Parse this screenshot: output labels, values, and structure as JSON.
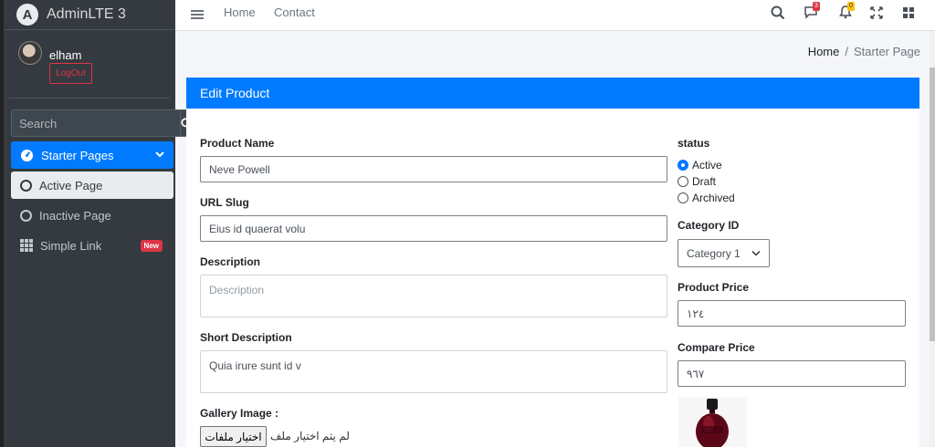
{
  "brand": {
    "name": "AdminLTE 3",
    "logo_letter": "A"
  },
  "user": {
    "name": "elham",
    "logout_label": "LogOut"
  },
  "sidebar": {
    "search_placeholder": "Search",
    "items": [
      {
        "label": "Starter Pages",
        "icon": "dashboard-icon",
        "state": "open"
      },
      {
        "label": "Active Page",
        "icon": "circle-icon",
        "state": "active"
      },
      {
        "label": "Inactive Page",
        "icon": "circle-icon"
      },
      {
        "label": "Simple Link",
        "icon": "grid-icon",
        "badge": "New"
      }
    ]
  },
  "topnav": {
    "links": [
      "Home",
      "Contact"
    ],
    "messages_count": "3",
    "notifications_count": "0"
  },
  "breadcrumb": {
    "home": "Home",
    "separator": "/",
    "current": "Starter Page"
  },
  "card": {
    "title": "Edit Product"
  },
  "form": {
    "product_name": {
      "label": "Product Name",
      "value": "Neve Powell"
    },
    "url_slug": {
      "label": "URL Slug",
      "value": "Eius id quaerat volu"
    },
    "description": {
      "label": "Description",
      "placeholder": "Description",
      "value": ""
    },
    "short_description": {
      "label": "Short Description",
      "value": "Quia irure sunt id v"
    },
    "gallery": {
      "label": "Gallery Image :",
      "button": "اختيار ملفات",
      "status": "لم يتم اختيار ملف"
    },
    "status": {
      "label": "status",
      "options": [
        "Active",
        "Draft",
        "Archived"
      ],
      "selected": "Active"
    },
    "category": {
      "label": "Category ID",
      "selected": "Category 1"
    },
    "product_price": {
      "label": "Product Price",
      "value": "١٢٤"
    },
    "compare_price": {
      "label": "Compare Price",
      "value": "٩٦٧"
    }
  },
  "colors": {
    "primary": "#007bff",
    "sidebar": "#343a40",
    "danger": "#dc3545",
    "warning": "#ffc107"
  }
}
